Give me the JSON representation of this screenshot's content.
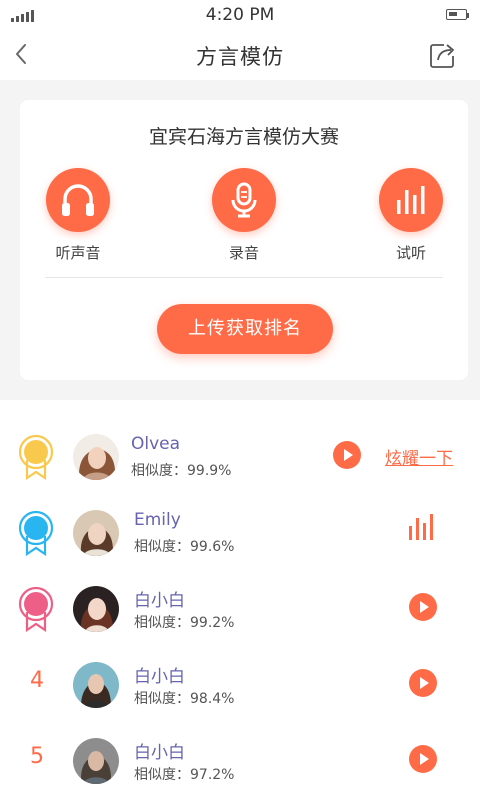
{
  "status": {
    "time": "4:20 PM"
  },
  "nav": {
    "title": "方言模仿"
  },
  "card": {
    "title": "宜宾石海方言模仿大赛",
    "controls": [
      {
        "label": "听声音",
        "icon": "headphones-icon"
      },
      {
        "label": "录音",
        "icon": "microphone-icon"
      },
      {
        "label": "试听",
        "icon": "audio-bars-icon"
      }
    ],
    "upload_label": "上传获取排名"
  },
  "leaderboard": {
    "brag_label": "炫耀一下",
    "medal_colors": [
      "#f9c94e",
      "#29b5f0",
      "#ee5f87"
    ],
    "accent": "#ff6a47",
    "rows": [
      {
        "rank": "1",
        "name": "Olvea",
        "similarity": "相似度：99.9%",
        "action": "play"
      },
      {
        "rank": "2",
        "name": "Emily",
        "similarity": "相似度：99.6%",
        "action": "playing"
      },
      {
        "rank": "3",
        "name": "白小白",
        "similarity": "相似度：99.2%",
        "action": "play"
      },
      {
        "rank": "4",
        "name": "白小白",
        "similarity": "相似度：98.4%",
        "action": "play"
      },
      {
        "rank": "5",
        "name": "白小白",
        "similarity": "相似度：97.2%",
        "action": "play"
      }
    ]
  }
}
